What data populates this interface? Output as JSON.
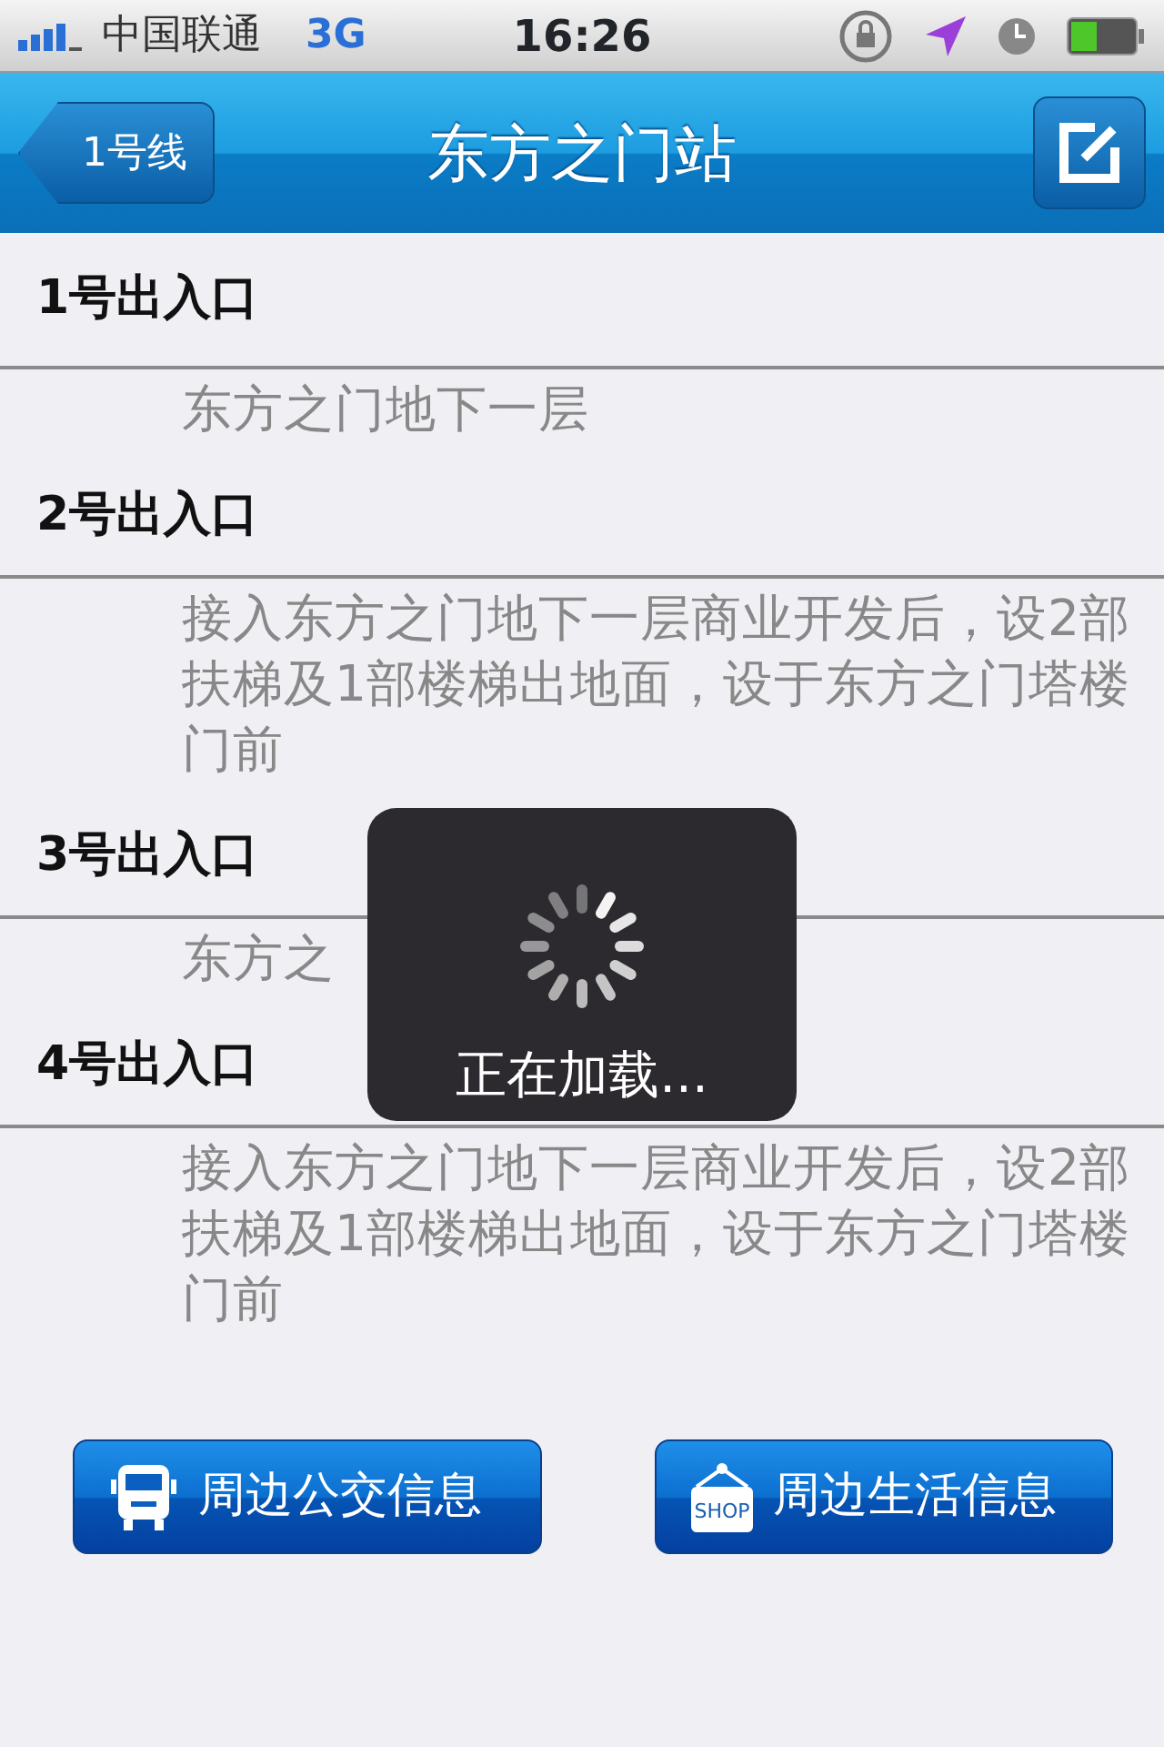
{
  "status_bar": {
    "carrier": "中国联通",
    "network": "3G",
    "time": "16:26"
  },
  "nav_bar": {
    "back_button": "1号线",
    "title": "东方之门站"
  },
  "exits": [
    {
      "name": "1号出入口",
      "description": "东方之门地下一层"
    },
    {
      "name": "2号出入口",
      "description": "接入东方之门地下一层商业开发后，设2部扶梯及1部楼梯出地面，设于东方之门塔楼门前"
    },
    {
      "name": "3号出入口",
      "description": "东方之"
    },
    {
      "name": "4号出入口",
      "description": "接入东方之门地下一层商业开发后，设2部扶梯及1部楼梯出地面，设于东方之门塔楼门前"
    }
  ],
  "buttons": [
    {
      "kind": "bus",
      "label": "周边公交信息"
    },
    {
      "kind": "shop",
      "label": "周边生活信息",
      "icon_text": "SHOP"
    }
  ],
  "loading": {
    "message": "正在加载..."
  }
}
